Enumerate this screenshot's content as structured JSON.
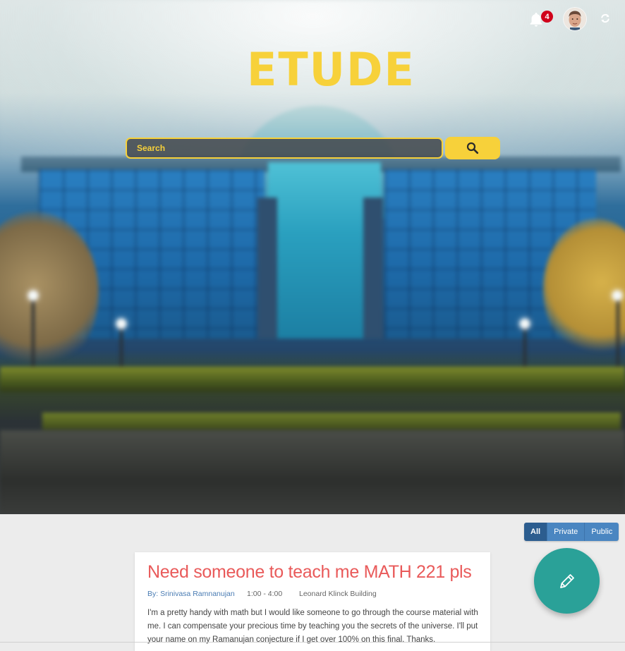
{
  "header": {
    "notification_count": "4",
    "icons": {
      "bell": "bell-icon",
      "avatar": "user-avatar",
      "refresh": "refresh-icon"
    }
  },
  "brand": {
    "logo_text": "ETUDE",
    "accent_color": "#f7d13a"
  },
  "search": {
    "placeholder": "Search",
    "button_icon": "search-icon"
  },
  "filter": {
    "options": [
      "All",
      "Private",
      "Public"
    ],
    "selected": "All"
  },
  "post": {
    "title": "Need someone to teach me MATH 221 pls",
    "author": "By: Srinivasa Ramnanujan",
    "time": "1:00 - 4:00",
    "location": "Leonard Klinck Building",
    "body": "I'm a pretty handy with math but I would like someone to go through the course material with me. I can compensate your precious time by teaching you the secrets of the universe. I'll put your name on my Ramanujan conjecture if I get over 100% on this final. Thanks."
  },
  "fab": {
    "icon": "pencil-icon",
    "color": "#2aa198"
  },
  "colors": {
    "title_red": "#e95a5a",
    "link_blue": "#4a7cb3",
    "badge_red": "#d0021b",
    "filter_active": "#2c5d8f",
    "filter_default": "#4a86c1"
  }
}
